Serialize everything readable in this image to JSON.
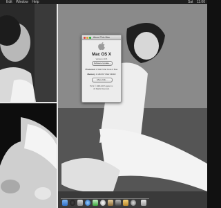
{
  "menubar": {
    "apple": "",
    "items": [
      "Edit",
      "Window",
      "Help"
    ],
    "right": [
      "Sat",
      "11:00"
    ]
  },
  "about": {
    "window_title": "About This Mac",
    "os_name": "Mac OS X",
    "version": "Version 10.5",
    "software_update_label": "Software Update...",
    "processor_label": "Processor",
    "processor_value": "2 GHz Intel Core 2 Duo",
    "memory_label": "Memory",
    "memory_value": "1 GB 667 MHz DDR2",
    "more_info_label": "More Info...",
    "footer_line1": "TM & © 1983-2007 Apple Inc.",
    "footer_line2": "All Rights Reserved."
  },
  "dock": {
    "icons": [
      "finder-icon",
      "dashboard-icon",
      "mail-icon",
      "safari-icon",
      "ichat-icon",
      "itunes-icon",
      "iphoto-icon",
      "imovie-icon",
      "garageband-icon",
      "system-preferences-icon",
      "trash-icon"
    ]
  },
  "colors": {
    "menubar": "#1e1e1e",
    "window": "#ececec",
    "divider": "#e8e8e8"
  }
}
